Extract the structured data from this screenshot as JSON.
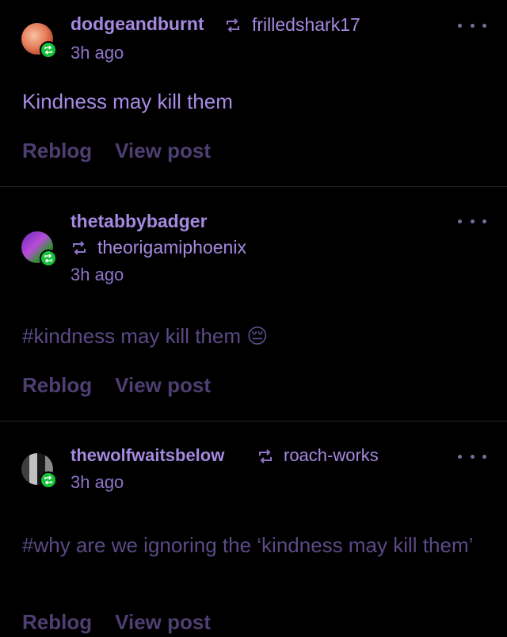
{
  "posts": [
    {
      "author": "dodgeandburnt",
      "reblogged_from": "frilledshark17",
      "time": "3h ago",
      "text": "Kindness may kill them",
      "reblog_label": "Reblog",
      "view_label": "View post"
    },
    {
      "author": "thetabbybadger",
      "reblogged_from": "theorigamiphoenix",
      "time": "3h ago",
      "text": "#kindness may kill them",
      "emoji": "😔",
      "reblog_label": "Reblog",
      "view_label": "View post"
    },
    {
      "author": "thewolfwaitsbelow",
      "reblogged_from": "roach-works",
      "time": "3h ago",
      "text": "#why are we ignoring the ‘kindness may kill them’",
      "reblog_label": "Reblog",
      "view_label": "View post"
    }
  ],
  "colors": {
    "background": "#000000",
    "username": "#a489e0",
    "body_text_post1": "#a78be6",
    "body_text_tags": "#5a4a86",
    "actions": "#4e3f73",
    "badge": "#19c23a"
  },
  "icons": {
    "reblog": "reblog-icon",
    "more": "more-options-icon"
  }
}
